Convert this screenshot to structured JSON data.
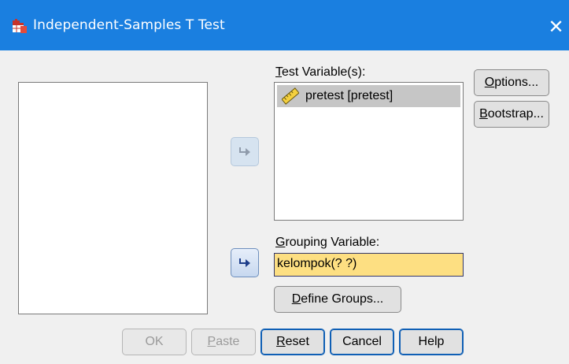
{
  "window": {
    "title": "Independent-Samples T Test",
    "close_glyph": "✕"
  },
  "labels": {
    "test_variables": {
      "mnemonic": "T",
      "rest": "est Variable(s):"
    },
    "grouping_variable": {
      "mnemonic": "G",
      "rest": "rouping Variable:"
    }
  },
  "test_variables": [
    {
      "label": "pretest [pretest]",
      "icon": "scale-ruler-icon"
    }
  ],
  "grouping_variable": {
    "value": "kelompok(? ?)"
  },
  "buttons": {
    "options": {
      "mnemonic": "O",
      "rest": "ptions..."
    },
    "bootstrap": {
      "mnemonic": "B",
      "rest": "ootstrap..."
    },
    "define_groups": {
      "mnemonic": "D",
      "rest": "efine Groups..."
    },
    "ok": {
      "label": "OK"
    },
    "paste": {
      "mnemonic": "P",
      "rest": "aste"
    },
    "reset": {
      "mnemonic": "R",
      "rest": "eset"
    },
    "cancel": {
      "label": "Cancel"
    },
    "help": {
      "label": "Help"
    }
  },
  "colors": {
    "titlebar": "#1a7fe0",
    "grouping_field": "#fddf82",
    "selected_item": "#c6c6c6"
  }
}
